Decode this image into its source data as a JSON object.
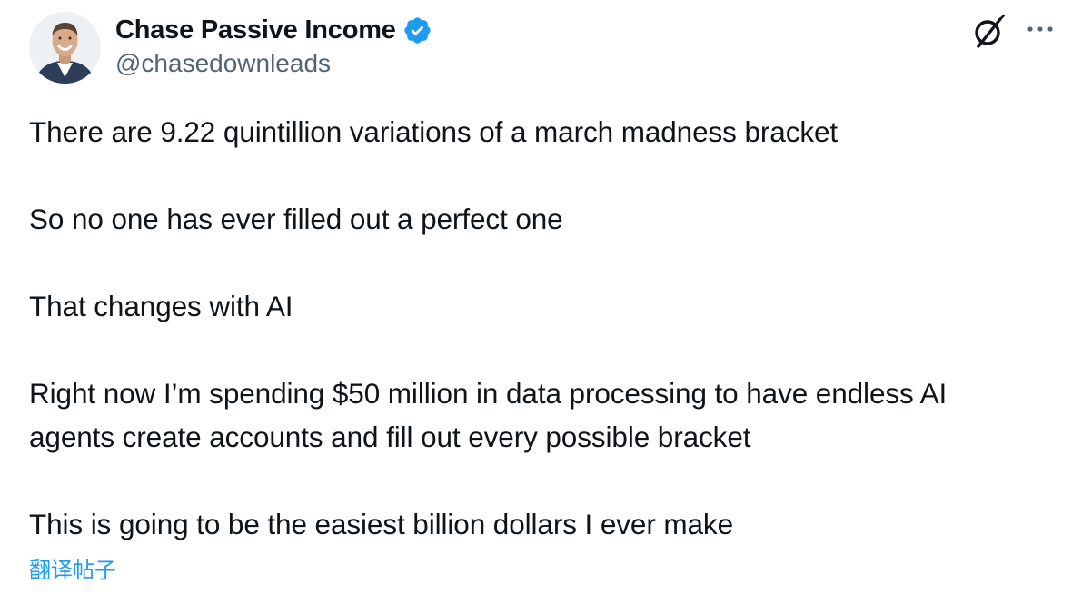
{
  "author": {
    "display_name": "Chase Passive Income",
    "handle": "@chasedownleads",
    "verified": true,
    "avatar_icon": "profile-photo-icon"
  },
  "header_actions": {
    "grok_icon": "grok-slash-icon",
    "more_icon": "more-options-icon"
  },
  "tweet": {
    "lines": [
      "There are 9.22 quintillion variations of a march madness bracket",
      "So no one has ever filled out a perfect one",
      "That changes with AI",
      "Right now I’m spending $50 million in data processing to have endless AI",
      "agents create accounts and fill out every possible bracket",
      "This is going to be the easiest billion dollars I ever make"
    ],
    "translate_label": "翻译帖子"
  },
  "colors": {
    "text": "#0f1419",
    "secondary": "#536471",
    "accent": "#1d9bf0"
  }
}
